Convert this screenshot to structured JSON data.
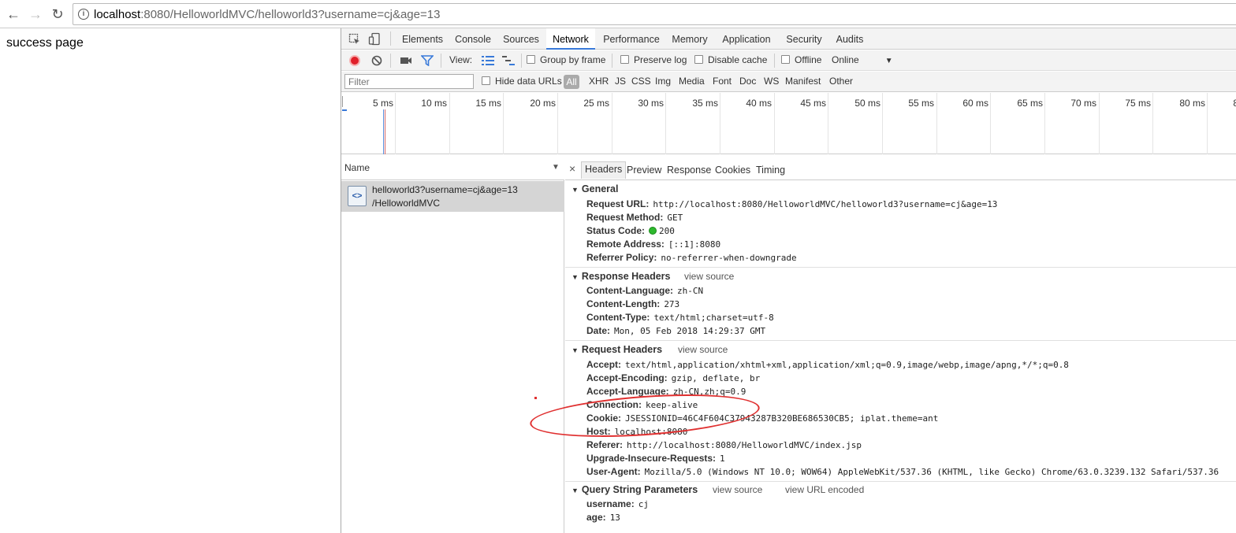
{
  "browser": {
    "url_host": "localhost",
    "url_rest": ":8080/HelloworldMVC/helloworld3?username=cj&age=13"
  },
  "page": {
    "text": "success page"
  },
  "devtools": {
    "tabs": [
      "Elements",
      "Console",
      "Sources",
      "Network",
      "Performance",
      "Memory",
      "Application",
      "Security",
      "Audits"
    ],
    "active_tab": "Network",
    "toolbar": {
      "view_label": "View:",
      "group_by_frame": "Group by frame",
      "preserve_log": "Preserve log",
      "disable_cache": "Disable cache",
      "offline": "Offline",
      "throttle": "Online"
    },
    "filterbar": {
      "filter_placeholder": "Filter",
      "hide_data_urls": "Hide data URLs",
      "types": [
        "All",
        "XHR",
        "JS",
        "CSS",
        "Img",
        "Media",
        "Font",
        "Doc",
        "WS",
        "Manifest",
        "Other"
      ]
    },
    "timeline_ticks": [
      "5 ms",
      "10 ms",
      "15 ms",
      "20 ms",
      "25 ms",
      "30 ms",
      "35 ms",
      "40 ms",
      "45 ms",
      "50 ms",
      "55 ms",
      "60 ms",
      "65 ms",
      "70 ms",
      "75 ms",
      "80 ms",
      "8"
    ],
    "name_pane": {
      "header": "Name",
      "request": {
        "name": "helloworld3?username=cj&age=13",
        "path": "/HelloworldMVC"
      }
    },
    "details": {
      "close": "×",
      "tabs": [
        "Headers",
        "Preview",
        "Response",
        "Cookies",
        "Timing"
      ],
      "general": {
        "title": "General",
        "lines": [
          {
            "k": "Request URL:",
            "v": "http://localhost:8080/HelloworldMVC/helloworld3?username=cj&age=13"
          },
          {
            "k": "Request Method:",
            "v": "GET"
          },
          {
            "k": "Status Code:",
            "v": "200"
          },
          {
            "k": "Remote Address:",
            "v": "[::1]:8080"
          },
          {
            "k": "Referrer Policy:",
            "v": "no-referrer-when-downgrade"
          }
        ]
      },
      "response_headers": {
        "title": "Response Headers",
        "view_source": "view source",
        "lines": [
          {
            "k": "Content-Language:",
            "v": "zh-CN"
          },
          {
            "k": "Content-Length:",
            "v": "273"
          },
          {
            "k": "Content-Type:",
            "v": "text/html;charset=utf-8"
          },
          {
            "k": "Date:",
            "v": "Mon, 05 Feb 2018 14:29:37 GMT"
          }
        ]
      },
      "request_headers": {
        "title": "Request Headers",
        "view_source": "view source",
        "lines": [
          {
            "k": "Accept:",
            "v": "text/html,application/xhtml+xml,application/xml;q=0.9,image/webp,image/apng,*/*;q=0.8"
          },
          {
            "k": "Accept-Encoding:",
            "v": "gzip, deflate, br"
          },
          {
            "k": "Accept-Language:",
            "v": "zh-CN,zh;q=0.9"
          },
          {
            "k": "Connection:",
            "v": "keep-alive"
          },
          {
            "k": "Cookie:",
            "v": "JSESSIONID=46C4F604C37943287B320BE686530CB5; iplat.theme=ant"
          },
          {
            "k": "Host:",
            "v": "localhost:8080"
          },
          {
            "k": "Referer:",
            "v": "http://localhost:8080/HelloworldMVC/index.jsp"
          },
          {
            "k": "Upgrade-Insecure-Requests:",
            "v": "1"
          },
          {
            "k": "User-Agent:",
            "v": "Mozilla/5.0 (Windows NT 10.0; WOW64) AppleWebKit/537.36 (KHTML, like Gecko) Chrome/63.0.3239.132 Safari/537.36"
          }
        ]
      },
      "query_params": {
        "title": "Query String Parameters",
        "view_source": "view source",
        "view_url_encoded": "view URL encoded",
        "lines": [
          {
            "k": "username:",
            "v": "cj"
          },
          {
            "k": "age:",
            "v": "13"
          }
        ]
      }
    }
  },
  "colors": {
    "accent": "#3879d9",
    "record": "#e0202a",
    "status_ok": "#2eb82e",
    "annotation": "#e03030"
  }
}
